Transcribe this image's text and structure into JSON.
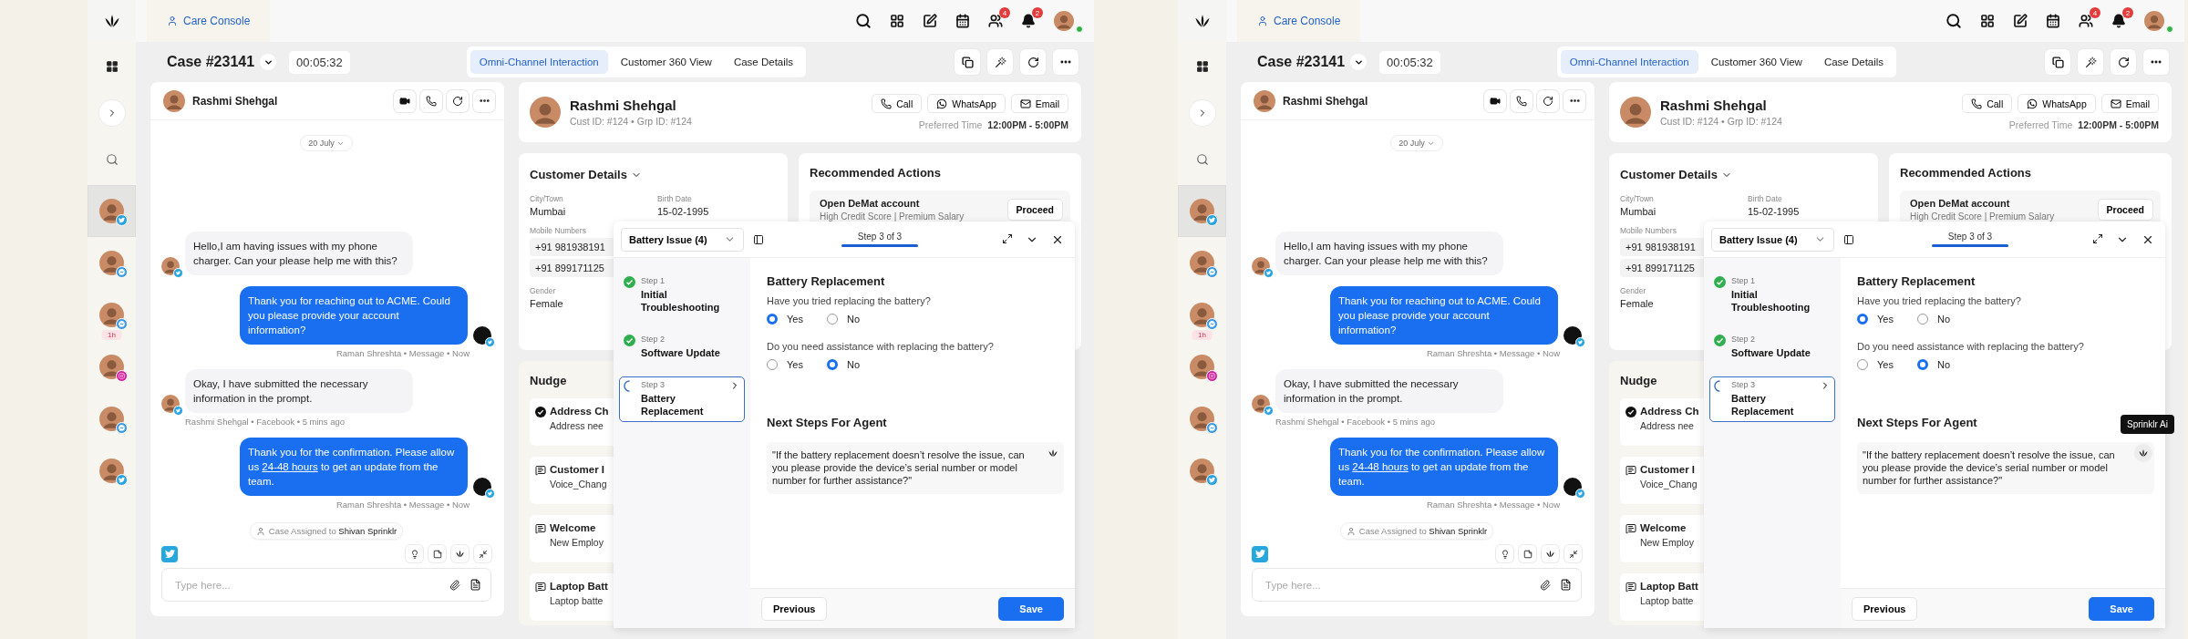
{
  "screens": [
    {
      "top_bar": {
        "tab": "Care Console",
        "badges": [
          "4",
          "2"
        ],
        "user_online": true
      },
      "rail": {
        "contacts": [
          {
            "kind": "twitter",
            "selected": true
          },
          {
            "kind": "messenger",
            "selected": false
          },
          {
            "kind": "messenger",
            "selected": false,
            "badge": "1h"
          },
          {
            "kind": "instagram",
            "selected": false
          },
          {
            "kind": "messenger",
            "selected": false
          },
          {
            "kind": "twitter",
            "selected": false
          }
        ]
      },
      "case": {
        "title": "Case #23141",
        "timer": "00:05:32",
        "tabs": [
          {
            "label": "Omni-Channel Interaction",
            "selected": true
          },
          {
            "label": "Customer 360 View",
            "selected": false
          },
          {
            "label": "Case Details",
            "selected": false
          }
        ]
      },
      "chat": {
        "name": "Rashmi Shehgal",
        "date": "20 July",
        "messages": [
          {
            "kind": "incoming",
            "parts": [
              {
                "text": "Hello,I am having issues with my phone charger. Can your please help me with this?"
              }
            ]
          },
          {
            "kind": "outgoing",
            "parts": [
              {
                "text": "Thank you for reaching out to ACME. Could you please provide your account information?"
              }
            ],
            "meta": "Raman Shreshta • Message • Now"
          },
          {
            "kind": "incoming",
            "parts": [
              {
                "text": "Okay, I have submitted the necessary information in the prompt."
              }
            ],
            "meta": "Rashmi Shehgal • Facebook • 5 mins ago"
          },
          {
            "kind": "outgoing",
            "parts": [
              {
                "text": "Thank you for the confirmation. Please allow us "
              },
              {
                "link": "24-48 hours"
              },
              {
                "text": " to get an update from the team."
              }
            ],
            "meta": "Raman Shreshta • Message • Now"
          }
        ],
        "assignment": "Case Assigned to **Shivan Sprinklr**",
        "placeholder": "Type here..."
      },
      "customer": {
        "name": "Rashmi Shehgal",
        "ids": "Cust ID: #124 • Grp ID: #124",
        "actions": [
          {
            "kind": "call",
            "label": "Call"
          },
          {
            "kind": "whatsapp",
            "label": "WhatsApp"
          },
          {
            "kind": "email",
            "label": "Email"
          }
        ],
        "preferred_label": "Preferred Time",
        "preferred_value": "12:00PM - 5:00PM"
      },
      "details": {
        "title": "Customer Details",
        "city_label": "City/Town",
        "city": "Mumbai",
        "birth_label": "Birth Date",
        "birth": "15-02-1995",
        "mobile_label": "Mobile Numbers",
        "mobiles": [
          "+91 981938191",
          "+91 899171125"
        ],
        "gender_label": "Gender",
        "gender": "Female"
      },
      "recommended": {
        "title": "Recommended Actions",
        "items": [
          {
            "title": "Open DeMat account",
            "subtitle": "High Credit Score | Premium Salary",
            "action": "Proceed"
          }
        ]
      },
      "nudge": {
        "title": "Nudge",
        "items": [
          {
            "kind": "done",
            "title": "Address Ch",
            "subtitle": "Address nee"
          },
          {
            "kind": "insight",
            "title": "Customer I",
            "subtitle": "Voice_Chang"
          },
          {
            "kind": "insight",
            "title": "Welcome",
            "subtitle": "New Employ"
          },
          {
            "kind": "insight",
            "title": "Laptop Batt",
            "subtitle": "Laptop batte"
          }
        ]
      },
      "workflow": {
        "select": "Battery Issue (4)",
        "progress_label": "Step 3 of 3",
        "level": 1,
        "steps": [
          {
            "label": "Step 1",
            "title": "Initial Troubleshooting",
            "kind": "done",
            "selected": false
          },
          {
            "label": "Step 2",
            "title": "Software Update",
            "kind": "done",
            "selected": false
          },
          {
            "label": "Step 3",
            "title": "Battery Replacement",
            "kind": "current",
            "selected": true
          }
        ],
        "title": "Battery Replacement",
        "questions": [
          {
            "text": "Have you tried replacing the battery?",
            "options": [
              {
                "label": "Yes",
                "selected": true
              },
              {
                "label": "No",
                "selected": false
              }
            ]
          },
          {
            "text": "Do you need assistance with replacing the battery?",
            "options": [
              {
                "label": "Yes",
                "selected": false
              },
              {
                "label": "No",
                "selected": true
              }
            ]
          }
        ],
        "next_steps_title": "Next Steps For Agent",
        "next_steps": "\"If the battery replacement doesn’t resolve the issue, can you please provide the device’s serial number or model number for further assistance?\"",
        "previous": "Previous",
        "save": "Save"
      }
    },
    {
      "top_bar": {
        "tab": "Care Console",
        "badges": [
          "4",
          "2"
        ],
        "user_online": true
      },
      "rail": {
        "contacts": [
          {
            "kind": "twitter",
            "selected": true
          },
          {
            "kind": "messenger",
            "selected": false
          },
          {
            "kind": "messenger",
            "selected": false,
            "badge": "1h"
          },
          {
            "kind": "instagram",
            "selected": false
          },
          {
            "kind": "messenger",
            "selected": false
          },
          {
            "kind": "twitter",
            "selected": false
          }
        ]
      },
      "case": {
        "title": "Case #23141",
        "timer": "00:05:32",
        "tabs": [
          {
            "label": "Omni-Channel Interaction",
            "selected": true
          },
          {
            "label": "Customer 360 View",
            "selected": false
          },
          {
            "label": "Case Details",
            "selected": false
          }
        ]
      },
      "chat": {
        "name": "Rashmi Shehgal",
        "date": "20 July",
        "messages": [
          {
            "kind": "incoming",
            "parts": [
              {
                "text": "Hello,I am having issues with my phone charger. Can your please help me with this?"
              }
            ]
          },
          {
            "kind": "outgoing",
            "parts": [
              {
                "text": "Thank you for reaching out to ACME. Could you please provide your account information?"
              }
            ],
            "meta": "Raman Shreshta • Message • Now"
          },
          {
            "kind": "incoming",
            "parts": [
              {
                "text": "Okay, I have submitted the necessary information in the prompt."
              }
            ],
            "meta": "Rashmi Shehgal • Facebook • 5 mins ago"
          },
          {
            "kind": "outgoing",
            "parts": [
              {
                "text": "Thank you for the confirmation. Please allow us "
              },
              {
                "link": "24-48 hours"
              },
              {
                "text": " to get an update from the team."
              }
            ],
            "meta": "Raman Shreshta • Message • Now"
          }
        ],
        "assignment": "Case Assigned to **Shivan Sprinklr**",
        "placeholder": "Type here..."
      },
      "customer": {
        "name": "Rashmi Shehgal",
        "ids": "Cust ID: #124 • Grp ID: #124",
        "actions": [
          {
            "kind": "call",
            "label": "Call"
          },
          {
            "kind": "whatsapp",
            "label": "WhatsApp"
          },
          {
            "kind": "email",
            "label": "Email"
          }
        ],
        "preferred_label": "Preferred Time",
        "preferred_value": "12:00PM - 5:00PM"
      },
      "details": {
        "title": "Customer Details",
        "city_label": "City/Town",
        "city": "Mumbai",
        "birth_label": "Birth Date",
        "birth": "15-02-1995",
        "mobile_label": "Mobile Numbers",
        "mobiles": [
          "+91 981938191",
          "+91 899171125"
        ],
        "gender_label": "Gender",
        "gender": "Female"
      },
      "recommended": {
        "title": "Recommended Actions",
        "items": [
          {
            "title": "Open DeMat account",
            "subtitle": "High Credit Score | Premium Salary",
            "action": "Proceed"
          }
        ]
      },
      "nudge": {
        "title": "Nudge",
        "items": [
          {
            "kind": "done",
            "title": "Address Ch",
            "subtitle": "Address nee"
          },
          {
            "kind": "insight",
            "title": "Customer I",
            "subtitle": "Voice_Chang"
          },
          {
            "kind": "insight",
            "title": "Welcome",
            "subtitle": "New Employ"
          },
          {
            "kind": "insight",
            "title": "Laptop Batt",
            "subtitle": "Laptop batte"
          }
        ]
      },
      "workflow": {
        "select": "Battery Issue (4)",
        "progress_label": "Step 3 of 3",
        "level": 1,
        "steps": [
          {
            "label": "Step 1",
            "title": "Initial Troubleshooting",
            "kind": "done",
            "selected": false
          },
          {
            "label": "Step 2",
            "title": "Software Update",
            "kind": "done",
            "selected": false
          },
          {
            "label": "Step 3",
            "title": "Battery Replacement",
            "kind": "current",
            "selected": true
          }
        ],
        "title": "Battery Replacement",
        "questions": [
          {
            "text": "Have you tried replacing the battery?",
            "options": [
              {
                "label": "Yes",
                "selected": true
              },
              {
                "label": "No",
                "selected": false
              }
            ]
          },
          {
            "text": "Do you need assistance with replacing the battery?",
            "options": [
              {
                "label": "Yes",
                "selected": false
              },
              {
                "label": "No",
                "selected": true
              }
            ]
          }
        ],
        "next_steps_title": "Next Steps For Agent",
        "next_steps": "\"If the battery replacement doesn’t resolve the issue, can you please provide the device’s serial number or model number for further assistance?\"",
        "tooltip": "Sprinklr Ai",
        "previous": "Previous",
        "save": "Save"
      }
    }
  ]
}
